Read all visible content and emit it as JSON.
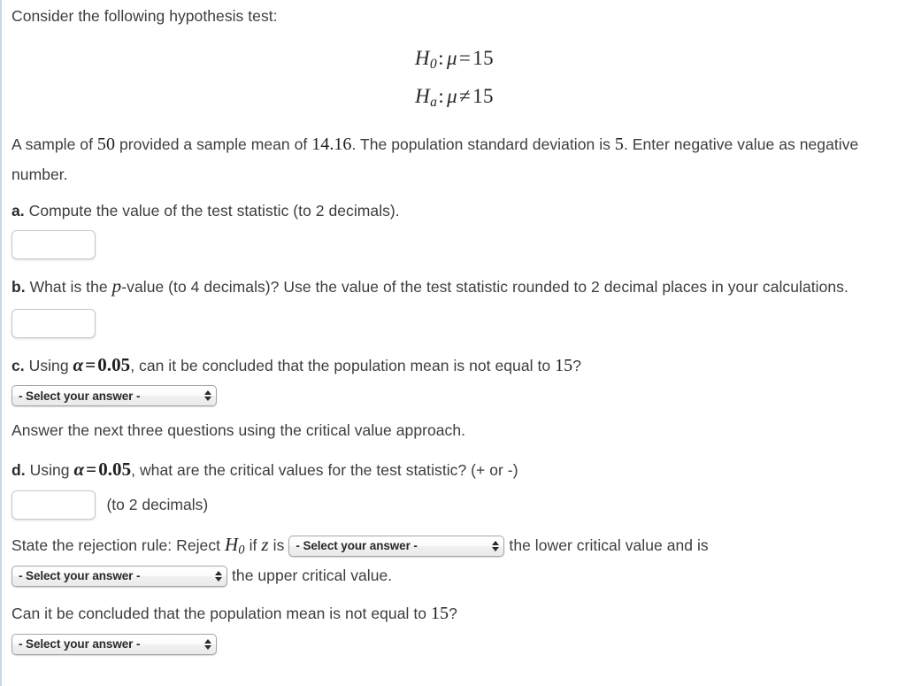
{
  "problem": {
    "intro": "Consider the following hypothesis test:",
    "hypotheses": [
      {
        "symbol": "H",
        "subscript": "0",
        "relation": "=",
        "variable": "μ",
        "value": "15"
      },
      {
        "symbol": "H",
        "subscript": "a",
        "relation": "≠",
        "variable": "μ",
        "value": "15"
      }
    ],
    "given": {
      "prefix": "A sample of",
      "sample_size": "50",
      "mid1": "provided a sample mean of",
      "sample_mean": "14.16",
      "mid2": ". The population standard deviation is",
      "population_sd": "5",
      "suffix": ". Enter negative value as negative number."
    }
  },
  "parts": {
    "a": {
      "letter": "a.",
      "text": "Compute the value of the test statistic (to 2 decimals).",
      "answer_value": "",
      "answer_placeholder": ""
    },
    "b": {
      "letter": "b.",
      "text_before_p": "What is the",
      "p_symbol": "p",
      "text_after_p": "-value (to 4 decimals)? Use the value of the test statistic rounded to 2 decimal places in your calculations.",
      "answer_value": "",
      "answer_placeholder": ""
    },
    "c": {
      "letter": "c.",
      "text_before": "Using",
      "alpha_symbol": "α",
      "alpha_relation": "=",
      "alpha_value": "0.05",
      "text_middle": ", can it be concluded that the population mean is not equal to",
      "mean_value": "15",
      "text_end": "?",
      "select_label": "- Select your answer -"
    },
    "critical_value_intro": "Answer the next three questions using the critical value approach.",
    "d": {
      "letter": "d.",
      "text_before": "Using",
      "alpha_symbol": "α",
      "alpha_relation": "=",
      "alpha_value": "0.05",
      "text_end": ", what are the critical values for the test statistic? (+ or -)",
      "answer_value": "",
      "answer_placeholder": "",
      "answer_note": "(to 2 decimals)"
    },
    "rejection_rule": {
      "text_start": "State the rejection rule: Reject",
      "h_symbol": "H",
      "h_subscript": "0",
      "text_if": "if",
      "z_symbol": "z",
      "text_is": "is",
      "select_lower_label": "- Select your answer -",
      "text_lower": "the lower critical value and is",
      "select_upper_label": "- Select your answer -",
      "text_upper": "the upper critical value."
    },
    "conclusion": {
      "text_before": "Can it be concluded that the population mean is not equal to",
      "mean_value": "15",
      "text_end": "?",
      "select_label": "- Select your answer -"
    }
  },
  "colors": {
    "page_background": "#ffffff",
    "body_text": "#3d3d3d",
    "math_text": "#222222",
    "left_rule": "#ccd6e4",
    "field_border": "#c8c8c8",
    "select_border": "#a6a6a6"
  }
}
